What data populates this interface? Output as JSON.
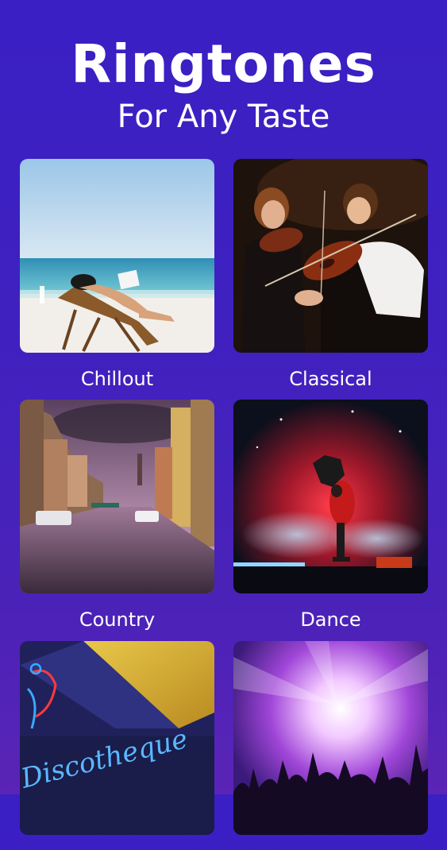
{
  "header": {
    "title": "Ringtones",
    "subtitle": "For Any Taste"
  },
  "categories": [
    {
      "label": "Chillout",
      "image": "beach-lounger-image"
    },
    {
      "label": "Classical",
      "image": "violinists-image"
    },
    {
      "label": "Country",
      "image": "canal-town-image"
    },
    {
      "label": "Dance",
      "image": "breakdancer-image"
    },
    {
      "label": "",
      "image": "discotheque-neon-image",
      "neon_text": "Discotheque"
    },
    {
      "label": "",
      "image": "concert-crowd-image"
    }
  ],
  "colors": {
    "background_top": "#3a1fc4",
    "background_bottom": "#5a24b6",
    "text": "#ffffff"
  }
}
